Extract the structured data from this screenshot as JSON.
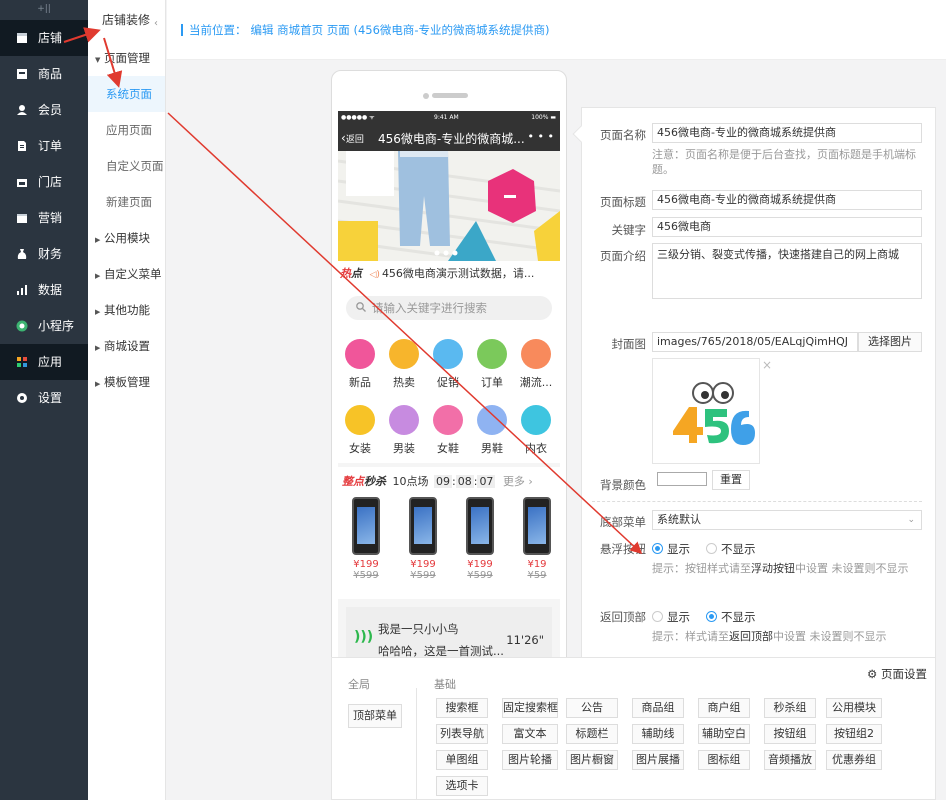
{
  "sidebar": {
    "top_mark": "+||",
    "items": [
      {
        "label": "店铺",
        "icon": "store-icon"
      },
      {
        "label": "商品",
        "icon": "goods-icon"
      },
      {
        "label": "会员",
        "icon": "member-icon"
      },
      {
        "label": "订单",
        "icon": "order-icon"
      },
      {
        "label": "门店",
        "icon": "shop-icon"
      },
      {
        "label": "营销",
        "icon": "marketing-icon"
      },
      {
        "label": "财务",
        "icon": "finance-icon"
      },
      {
        "label": "数据",
        "icon": "data-icon"
      },
      {
        "label": "小程序",
        "icon": "miniprogram-icon"
      },
      {
        "label": "应用",
        "icon": "apps-icon"
      },
      {
        "label": "设置",
        "icon": "gear-icon"
      }
    ]
  },
  "subnav": {
    "title": "店铺装修",
    "groups": [
      {
        "label": "页面管理",
        "expanded": true,
        "children": [
          "系统页面",
          "应用页面",
          "自定义页面",
          "新建页面"
        ]
      },
      {
        "label": "公用模块"
      },
      {
        "label": "自定义菜单"
      },
      {
        "label": "其他功能"
      },
      {
        "label": "商城设置"
      },
      {
        "label": "模板管理"
      }
    ]
  },
  "breadcrumb": {
    "label": "当前位置：",
    "path": "编辑 商城首页 页面 (456微电商-专业的微商城系统提供商)"
  },
  "phone": {
    "status_left": "●●●●● ᯤ",
    "status_time": "9:41 AM",
    "status_right": "100% ▬",
    "back_label": "返回",
    "nav_title": "456微电商-专业的微商城...",
    "nav_more": "• • •",
    "notice_tag_a": "热",
    "notice_tag_b": "点",
    "notice_text": "456微电商演示测试数据，请...",
    "search_placeholder": "请输入关键字进行搜索",
    "categories": [
      {
        "label": "新品",
        "color": "#f0569a"
      },
      {
        "label": "热卖",
        "color": "#f7b52c"
      },
      {
        "label": "促销",
        "color": "#5ab9f0"
      },
      {
        "label": "订单",
        "color": "#7bc95b"
      },
      {
        "label": "潮流...",
        "color": "#f88a5c"
      },
      {
        "label": "女装",
        "color": "#f7c327"
      },
      {
        "label": "男装",
        "color": "#c78be0"
      },
      {
        "label": "女鞋",
        "color": "#f26fa8"
      },
      {
        "label": "男鞋",
        "color": "#8fb3f2"
      },
      {
        "label": "内衣",
        "color": "#3ec5e0"
      }
    ],
    "seckill": {
      "title_a": "整点",
      "title_b": "秒杀",
      "session": "10点场",
      "h": "09",
      "m": "08",
      "s": "07",
      "more": "更多 ›",
      "products": [
        {
          "price": "¥199",
          "orig": "¥599"
        },
        {
          "price": "¥199",
          "orig": "¥599"
        },
        {
          "price": "¥199",
          "orig": "¥599"
        },
        {
          "price": "¥19",
          "orig": "¥59"
        }
      ]
    },
    "audio": {
      "title": "我是一只小小鸟",
      "subtitle": "哈哈哈，这是一首测试...",
      "duration": "11'26\""
    }
  },
  "form": {
    "page_name_label": "页面名称",
    "page_name_value": "456微电商-专业的微商城系统提供商",
    "page_name_hint": "注意：页面名称是便于后台查找，页面标题是手机端标题。",
    "page_title_label": "页面标题",
    "page_title_value": "456微电商-专业的微商城系统提供商",
    "keyword_label": "关键字",
    "keyword_value": "456微电商",
    "intro_label": "页面介绍",
    "intro_value": "三级分销、裂变式传播，快速搭建自己的网上商城",
    "cover_label": "封面图",
    "cover_value": "images/765/2018/05/EALqjQimHQJ",
    "cover_button": "选择图片",
    "cover_close": "×",
    "bg_label": "背景颜色",
    "bg_reset": "重置",
    "menu_label": "底部菜单",
    "menu_value": "系统默认",
    "float_label": "悬浮按钮",
    "float_show": "显示",
    "float_hide": "不显示",
    "float_hint_a": "提示：按钮样式请至",
    "float_hint_b": "浮动按钮",
    "float_hint_c": "中设置 未设置则不显示",
    "top_label": "返回顶部",
    "top_show": "显示",
    "top_hide": "不显示",
    "top_hint_a": "提示：样式请至",
    "top_hint_b": "返回顶部",
    "top_hint_c": "中设置 未设置则不显示"
  },
  "components": {
    "page_settings": "页面设置",
    "global_title": "全局",
    "basic_title": "基础",
    "global_items": [
      "顶部菜单"
    ],
    "basic_items": [
      "搜索框",
      "固定搜索框",
      "公告",
      "商品组",
      "商户组",
      "秒杀组",
      "公用模块",
      "列表导航",
      "富文本",
      "标题栏",
      "辅助线",
      "辅助空白",
      "按钮组",
      "按钮组2",
      "单图组",
      "图片轮播",
      "图片橱窗",
      "图片展播",
      "图标组",
      "音频播放",
      "优惠券组",
      "选项卡"
    ]
  },
  "colors": {
    "accent": "#2b9af3",
    "sidebar": "#2b3540",
    "arrow": "#e03a2f",
    "price": "#e4393c"
  }
}
